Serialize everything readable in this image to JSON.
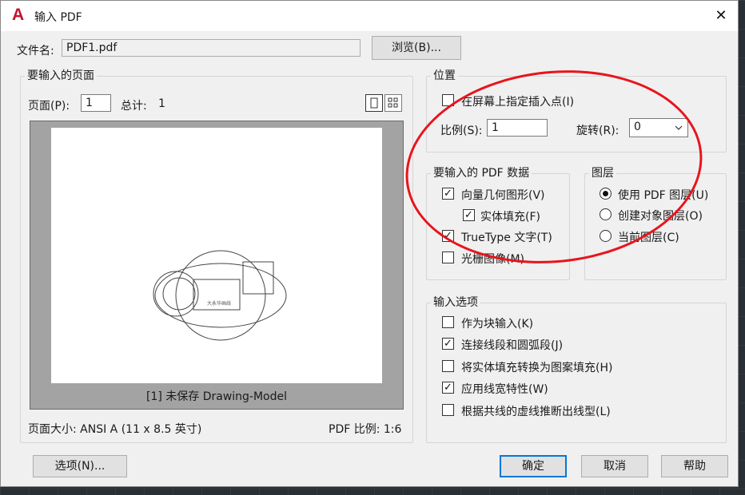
{
  "window": {
    "title": "输入 PDF",
    "close_glyph": "✕",
    "logo_glyph": "A"
  },
  "file": {
    "label": "文件名:",
    "value": "PDF1.pdf",
    "browse_label": "浏览(B)..."
  },
  "pages_group": {
    "title": "要输入的页面",
    "page_label": "页面(P):",
    "page_value": "1",
    "total_label": "总计:",
    "total_value": "1",
    "preview_caption": "[1] 未保存 Drawing-Model",
    "preview_tiny_text": "大永华画线",
    "page_size": "页面大小: ANSI A (11 x 8.5 英寸)",
    "pdf_scale": "PDF 比例: 1:6"
  },
  "position_group": {
    "title": "位置",
    "specify_onscreen": {
      "label": "在屏幕上指定插入点(I)",
      "checked": false
    },
    "scale_label": "比例(S):",
    "scale_value": "1",
    "rotation_label": "旋转(R):",
    "rotation_value": "0"
  },
  "pdf_data_group": {
    "title": "要输入的 PDF 数据",
    "items": [
      {
        "label": "向量几何图形(V)",
        "checked": true
      },
      {
        "label": "实体填充(F)",
        "checked": true
      },
      {
        "label": "TrueType 文字(T)",
        "checked": true
      },
      {
        "label": "光栅图像(M)",
        "checked": false
      }
    ]
  },
  "layers_group": {
    "title": "图层",
    "items": [
      {
        "label": "使用 PDF 图层(U)",
        "selected": true
      },
      {
        "label": "创建对象图层(O)",
        "selected": false
      },
      {
        "label": "当前图层(C)",
        "selected": false
      }
    ]
  },
  "import_options_group": {
    "title": "输入选项",
    "items": [
      {
        "label": "作为块输入(K)",
        "checked": false
      },
      {
        "label": "连接线段和圆弧段(J)",
        "checked": true
      },
      {
        "label": "将实体填充转换为图案填充(H)",
        "checked": false
      },
      {
        "label": "应用线宽特性(W)",
        "checked": true
      },
      {
        "label": "根据共线的虚线推断出线型(L)",
        "checked": false
      }
    ]
  },
  "footer": {
    "options_label": "选项(N)...",
    "ok_label": "确定",
    "cancel_label": "取消",
    "help_label": "帮助"
  },
  "colors": {
    "annotation_circle": "#e8141c",
    "focus_border": "#0078d7",
    "logo": "#c8102e"
  },
  "icons": {
    "single_view": "single-page-view-icon",
    "grid_view": "grid-view-icon",
    "check": "✓",
    "dropdown": "chevron-down-icon"
  }
}
